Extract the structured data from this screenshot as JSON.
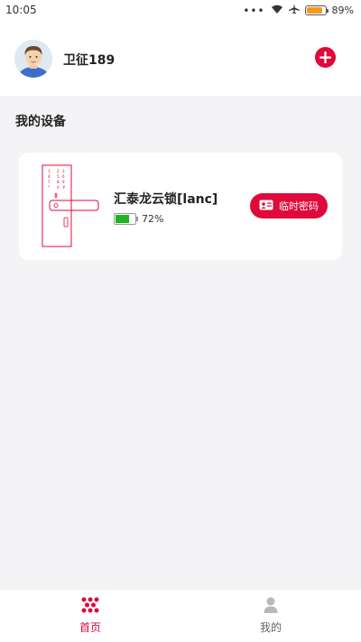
{
  "status_bar": {
    "time": "10:05",
    "battery_percent": "89%",
    "battery_level": 0.89
  },
  "header": {
    "username": "卫征189"
  },
  "section": {
    "title": "我的设备"
  },
  "device": {
    "name": "汇泰龙云锁[lanc]",
    "battery_text": "72%",
    "battery_level": 0.72,
    "temp_password_label": "临时密码"
  },
  "tabs": [
    {
      "label": "首页",
      "active": true
    },
    {
      "label": "我的",
      "active": false
    }
  ],
  "colors": {
    "accent": "#e0093a",
    "battery_green": "#1db51d",
    "status_battery": "#f39a1c",
    "page_bg": "#f4f4f6"
  }
}
